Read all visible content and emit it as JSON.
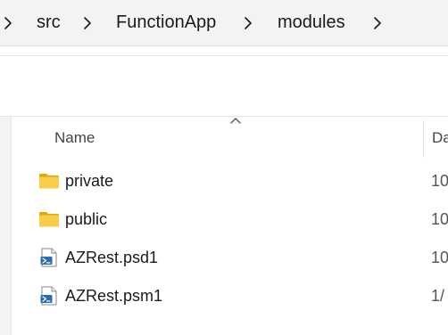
{
  "breadcrumb": {
    "items": [
      {
        "label": "src"
      },
      {
        "label": "FunctionApp"
      },
      {
        "label": "modules"
      }
    ]
  },
  "list": {
    "columns": {
      "name": "Name",
      "date": "Da"
    },
    "rows": [
      {
        "name": "private",
        "date": "10",
        "icon": "folder-icon"
      },
      {
        "name": "public",
        "date": "10",
        "icon": "folder-icon"
      },
      {
        "name": "AZRest.psd1",
        "date": "10",
        "icon": "powershell-file-icon"
      },
      {
        "name": "AZRest.psm1",
        "date": "1/",
        "icon": "powershell-file-icon"
      }
    ]
  },
  "colors": {
    "folder": "#f5c542",
    "folder_dark": "#e0a800",
    "chrome": "#f3f3f3",
    "accent": "#2b6cb0"
  }
}
